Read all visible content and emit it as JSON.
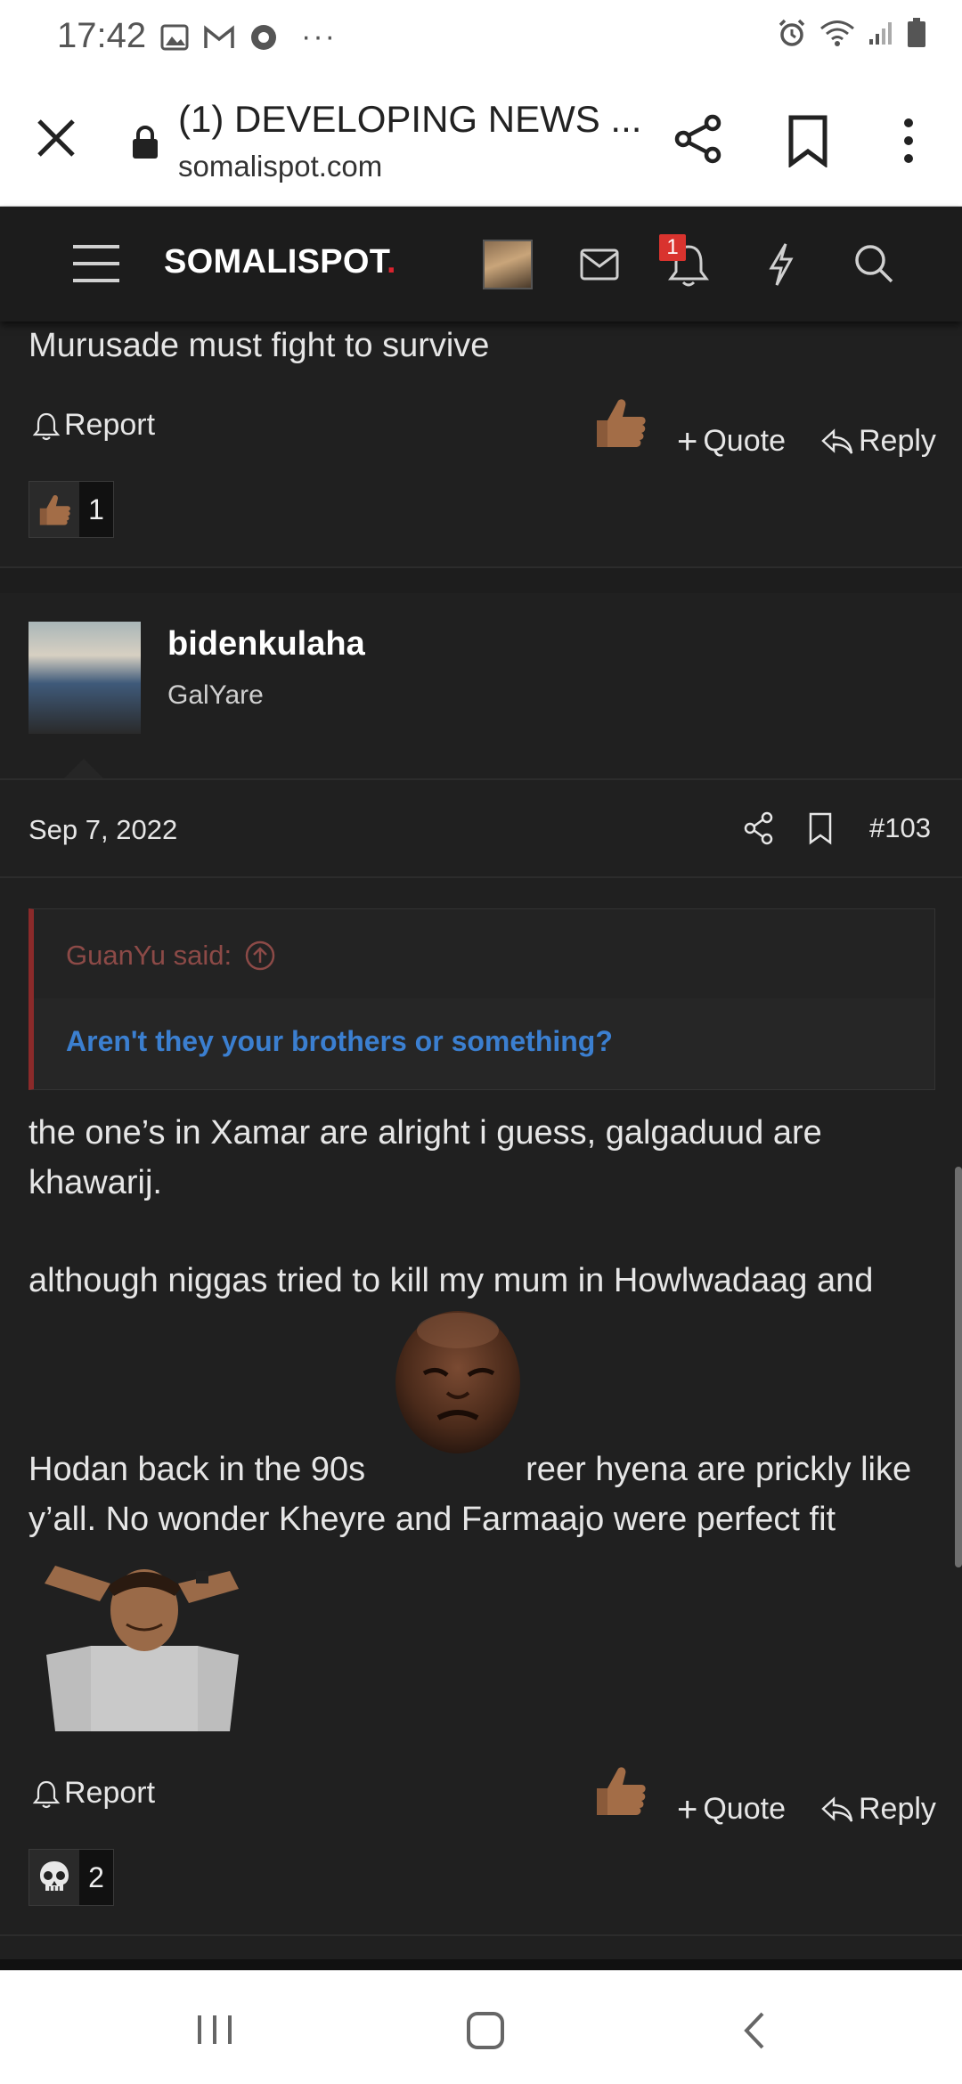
{
  "status_bar": {
    "time": "17:42"
  },
  "browser": {
    "page_title": "(1) DEVELOPING NEWS ...",
    "url": "somalispot.com"
  },
  "site_header": {
    "logo_text": "SOMALISPOT",
    "logo_dot": ".",
    "notification_count": "1"
  },
  "post_prev": {
    "text": "Murusade must fight to survive",
    "report_label": "Report",
    "quote_label": "Quote",
    "reply_label": "Reply",
    "reaction_count": "1"
  },
  "post": {
    "username": "bidenkulaha",
    "user_title": "GalYare",
    "date": "Sep 7, 2022",
    "post_number": "#103",
    "quote_author": "GuanYu said:",
    "quote_text": "Aren't they your brothers or something?",
    "para1": "the one’s in Xamar are alright i guess, galgaduud are khawarij.",
    "para2": "although niggas tried to kill my mum in Howlwadaag and",
    "para3a": "Hodan back in the 90s",
    "para3b": "reer hyena are prickly like",
    "para4": "y’all. No wonder Kheyre and Farmaajo were perfect fit",
    "report_label": "Report",
    "quote_label": "Quote",
    "reply_label": "Reply",
    "reaction_count": "2"
  },
  "colors": {
    "background": "#202020",
    "quote_border": "#8b2a2a",
    "quote_link": "#3b7fd0",
    "badge": "#d9332e"
  }
}
